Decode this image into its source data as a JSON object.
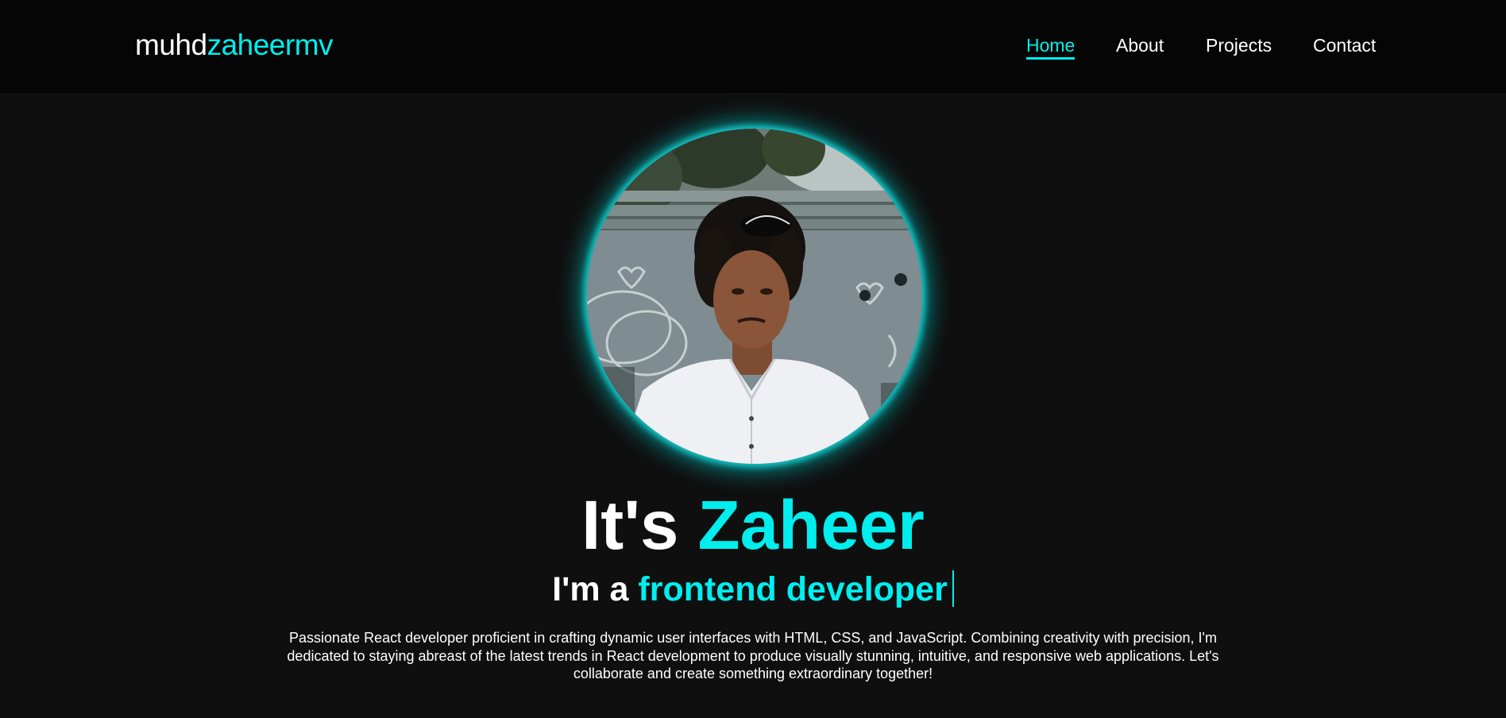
{
  "header": {
    "logo_first": "muhd",
    "logo_second": "zaheermv",
    "nav": [
      {
        "label": "Home",
        "active": true
      },
      {
        "label": "About",
        "active": false
      },
      {
        "label": "Projects",
        "active": false
      },
      {
        "label": "Contact",
        "active": false
      }
    ]
  },
  "hero": {
    "avatar_icon": "profile-photo",
    "title_prefix": "It's",
    "title_name": "Zaheer",
    "subtitle_prefix": "I'm a",
    "subtitle_role": "frontend developer",
    "description": "Passionate React developer proficient in crafting dynamic user interfaces with HTML, CSS, and JavaScript. Combining creativity with precision, I'm dedicated to staying abreast of the latest trends in React development to produce visually stunning, intuitive, and responsive web applications. Let's collaborate and create something extraordinary together!"
  },
  "colors": {
    "accent": "#00eeee",
    "background": "#0f0f0f",
    "header_background": "#050505",
    "text": "#ffffff"
  }
}
